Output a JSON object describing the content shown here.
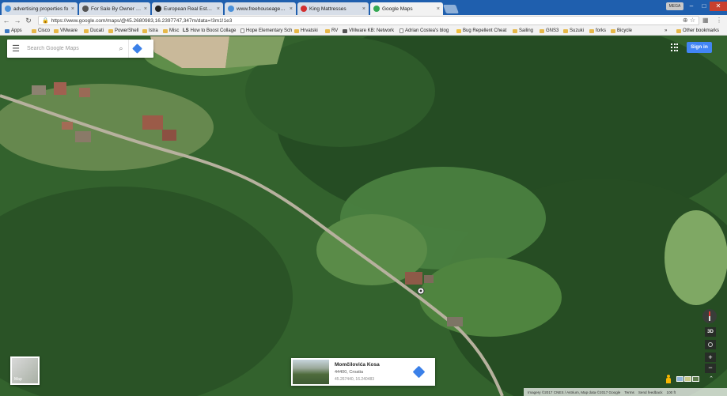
{
  "window": {
    "tabs": [
      {
        "label": "advertising properties fo",
        "favicon_color": "#4a90d9"
      },
      {
        "label": "For Sale By Owner in Eur",
        "favicon_color": "#555555"
      },
      {
        "label": "European Real Estate Ad",
        "favicon_color": "#222222"
      },
      {
        "label": "www.freehouseagent.com",
        "favicon_color": "#4a90d9"
      },
      {
        "label": "King Mattresses",
        "favicon_color": "#d32f2f"
      },
      {
        "label": "Google Maps",
        "favicon_color": "#34a853"
      }
    ],
    "tab_close_glyph": "×",
    "user_chip": "MEGA"
  },
  "toolbar": {
    "url": "https://www.google.com/maps/@45.2680983,16.2397747,347m/data=!3m1!1e3"
  },
  "bookmarks": {
    "apps": "Apps",
    "items": [
      "Cisco",
      "VMware",
      "Ducati",
      "PowerShell",
      "Istra",
      "Misc",
      "How to Boost Collage",
      "Hope Elementary Sch",
      "Hrvatski",
      "RV",
      "VMware KB: Network",
      "Adrian Costea's blog",
      "Bug Repellent Cheat",
      "Sailing",
      "GNS3",
      "Suzuki",
      "forks",
      "Bicycle"
    ],
    "overflow": "»",
    "other": "Other bookmarks"
  },
  "maps": {
    "search_placeholder": "Search Google Maps",
    "signin_label": "Sign in",
    "minimap_label": "Map",
    "place_card": {
      "title": "Momčilovića Kosa",
      "address": "44400, Croatia",
      "coords": "45.267440, 16.240483"
    },
    "controls": {
      "label_3d": "3D",
      "zoom_in": "+",
      "zoom_out": "−",
      "expand": "⌃"
    },
    "footer": {
      "imagery": "Imagery ©2017 CNES / Astrium, Map data ©2017 Google",
      "terms": "Terms",
      "feedback": "Send feedback",
      "scale": "100 ft"
    }
  }
}
